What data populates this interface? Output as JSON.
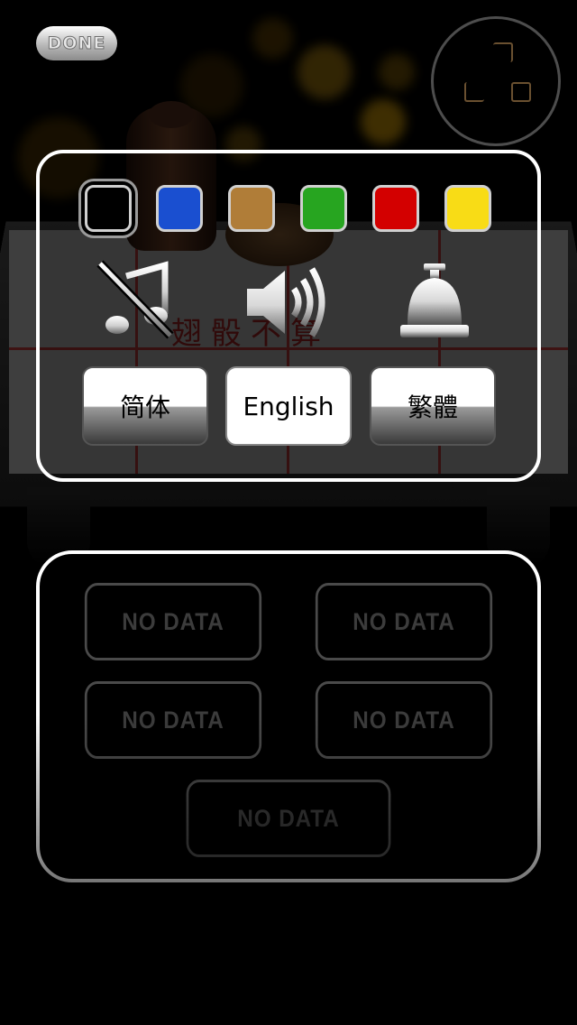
{
  "top_bar": {
    "done_label": "DONE",
    "fullscreen_icon": "fullscreen-corners-icon"
  },
  "settings": {
    "color_swatches": [
      {
        "name": "black",
        "color": "#000000",
        "selected": true
      },
      {
        "name": "blue",
        "color": "#1a4fd0",
        "selected": false
      },
      {
        "name": "tan",
        "color": "#b07d38",
        "selected": false
      },
      {
        "name": "green",
        "color": "#27a520",
        "selected": false
      },
      {
        "name": "red",
        "color": "#d30000",
        "selected": false
      },
      {
        "name": "yellow",
        "color": "#f8dc16",
        "selected": false
      }
    ],
    "sound_controls": {
      "music": {
        "icon": "music-muted-icon",
        "enabled": false
      },
      "volume": {
        "icon": "speaker-volume-icon",
        "enabled": true
      },
      "bell": {
        "icon": "bell-icon"
      }
    },
    "languages": [
      {
        "label": "简体",
        "active": false
      },
      {
        "label": "English",
        "active": true
      },
      {
        "label": "繁體",
        "active": false
      }
    ]
  },
  "scores": {
    "slots": [
      "NO DATA",
      "NO DATA",
      "NO DATA",
      "NO DATA",
      "NO DATA"
    ]
  }
}
